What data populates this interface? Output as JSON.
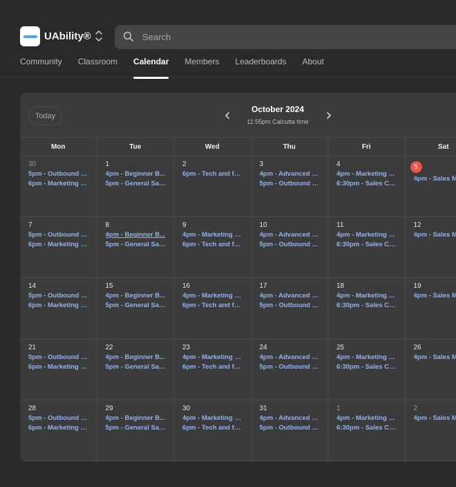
{
  "app": {
    "brand": "UAbility®",
    "search_placeholder": "Search"
  },
  "tabs": [
    "Community",
    "Classroom",
    "Calendar",
    "Members",
    "Leaderboards",
    "About"
  ],
  "active_tab": "Calendar",
  "calendar": {
    "today_label": "Today",
    "month": "October 2024",
    "timezone": "11:55pm Calcutta time",
    "weekdays": [
      "Mon",
      "Tue",
      "Wed",
      "Thu",
      "Fri",
      "Sat"
    ],
    "weeks": [
      [
        {
          "day": "30",
          "muted": true,
          "events": [
            "5pm - Outbound & ...",
            "6pm - Marketing a..."
          ]
        },
        {
          "day": "1",
          "events": [
            "4pm - Beginner B...",
            "5pm - General Sal..."
          ]
        },
        {
          "day": "2",
          "events": [
            "6pm - Tech and fu..."
          ]
        },
        {
          "day": "3",
          "events": [
            "4pm - Advanced B...",
            "5pm - Outbound a..."
          ]
        },
        {
          "day": "4",
          "events": [
            "4pm - Marketing Q...",
            "6:30pm - Sales Cal..."
          ]
        },
        {
          "day": "5",
          "today": true,
          "events": [
            "4pm - Sales M"
          ]
        }
      ],
      [
        {
          "day": "7",
          "events": [
            "5pm - Outbound & ...",
            "6pm - Marketing a..."
          ]
        },
        {
          "day": "8",
          "events": [
            "4pm - Beginner B...",
            "5pm - General Sal..."
          ],
          "hover_first": true
        },
        {
          "day": "9",
          "events": [
            "4pm - Marketing &...",
            "6pm - Tech and fu..."
          ]
        },
        {
          "day": "10",
          "events": [
            "4pm - Advanced B...",
            "5pm - Outbound a..."
          ]
        },
        {
          "day": "11",
          "events": [
            "4pm - Marketing Q...",
            "6:30pm - Sales Cal..."
          ]
        },
        {
          "day": "12",
          "events": [
            "4pm - Sales M"
          ]
        }
      ],
      [
        {
          "day": "14",
          "events": [
            "5pm - Outbound & ...",
            "6pm - Marketing a..."
          ]
        },
        {
          "day": "15",
          "events": [
            "4pm - Beginner B...",
            "5pm - General Sal..."
          ]
        },
        {
          "day": "16",
          "events": [
            "4pm - Marketing &...",
            "6pm - Tech and fu..."
          ]
        },
        {
          "day": "17",
          "events": [
            "4pm - Advanced B...",
            "5pm - Outbound a..."
          ]
        },
        {
          "day": "18",
          "events": [
            "4pm - Marketing Q...",
            "6:30pm - Sales Cal..."
          ]
        },
        {
          "day": "19",
          "events": [
            "4pm - Sales M"
          ]
        }
      ],
      [
        {
          "day": "21",
          "events": [
            "5pm - Outbound & ...",
            "6pm - Marketing a..."
          ]
        },
        {
          "day": "22",
          "events": [
            "4pm - Beginner B...",
            "5pm - General Sal..."
          ]
        },
        {
          "day": "23",
          "events": [
            "4pm - Marketing &...",
            "6pm - Tech and fu..."
          ]
        },
        {
          "day": "24",
          "events": [
            "4pm - Advanced B...",
            "5pm - Outbound a..."
          ]
        },
        {
          "day": "25",
          "events": [
            "4pm - Marketing Q...",
            "6:30pm - Sales Cal..."
          ]
        },
        {
          "day": "26",
          "events": [
            "4pm - Sales M"
          ]
        }
      ],
      [
        {
          "day": "28",
          "events": [
            "5pm - Outbound & ...",
            "6pm - Marketing a..."
          ]
        },
        {
          "day": "29",
          "events": [
            "4pm - Beginner B...",
            "5pm - General Sal..."
          ]
        },
        {
          "day": "30",
          "events": [
            "4pm - Marketing &...",
            "6pm - Tech and fu..."
          ]
        },
        {
          "day": "31",
          "events": [
            "4pm - Advanced B...",
            "5pm - Outbound a..."
          ]
        },
        {
          "day": "1",
          "muted": true,
          "events": [
            "4pm - Marketing Q...",
            "6:30pm - Sales Cal..."
          ]
        },
        {
          "day": "2",
          "muted": true,
          "events": [
            "4pm - Sales M"
          ]
        }
      ]
    ]
  }
}
